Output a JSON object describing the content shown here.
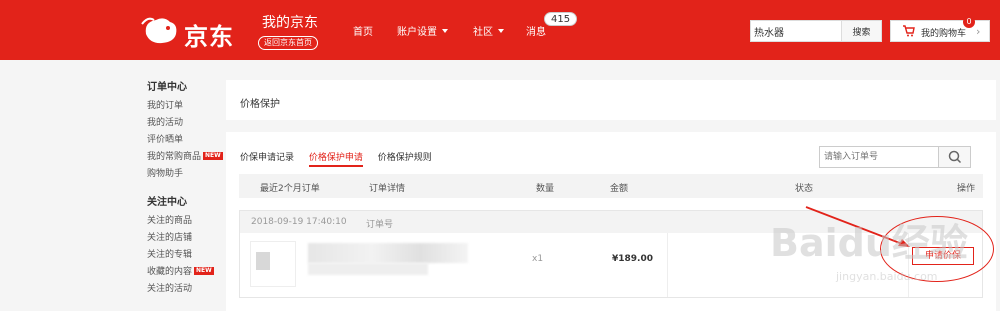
{
  "header": {
    "brand": "京东",
    "my_jd": "我的京东",
    "back_home": "返回京东首页",
    "nav": [
      {
        "label": "首页",
        "dropdown": false
      },
      {
        "label": "账户设置",
        "dropdown": true
      },
      {
        "label": "社区",
        "dropdown": true
      },
      {
        "label": "消息",
        "dropdown": false
      }
    ],
    "message_count": "415",
    "search_value": "热水器",
    "search_button": "搜索",
    "cart_label": "我的购物车",
    "cart_count": "0",
    "colors": {
      "brand_red": "#e2231a"
    }
  },
  "sidebar": {
    "groups": [
      {
        "title": "订单中心",
        "items": [
          {
            "label": "我的订单",
            "new": false
          },
          {
            "label": "我的活动",
            "new": false
          },
          {
            "label": "评价晒单",
            "new": false
          },
          {
            "label": "我的常购商品",
            "new": true
          },
          {
            "label": "购物助手",
            "new": false
          }
        ]
      },
      {
        "title": "关注中心",
        "items": [
          {
            "label": "关注的商品",
            "new": false
          },
          {
            "label": "关注的店铺",
            "new": false
          },
          {
            "label": "关注的专辑",
            "new": false
          },
          {
            "label": "收藏的内容",
            "new": true
          },
          {
            "label": "关注的活动",
            "new": false
          }
        ]
      }
    ],
    "new_tag": "NEW"
  },
  "page": {
    "title": "价格保护"
  },
  "tabs": [
    {
      "label": "价保申请记录",
      "active": false
    },
    {
      "label": "价格保护申请",
      "active": true
    },
    {
      "label": "价格保护规则",
      "active": false
    }
  ],
  "order_search": {
    "placeholder": "请输入订单号"
  },
  "table": {
    "columns": [
      "最近2个月订单",
      "订单详情",
      "数量",
      "金额",
      "状态",
      "操作"
    ]
  },
  "order": {
    "datetime": "2018-09-19 17:40:10",
    "order_no_label": "订单号",
    "quantity": "x1",
    "amount": "¥189.00",
    "action": "申请价保"
  },
  "watermark": {
    "text": "Baidu经验",
    "url_text": "jingyan.baidu.com"
  }
}
